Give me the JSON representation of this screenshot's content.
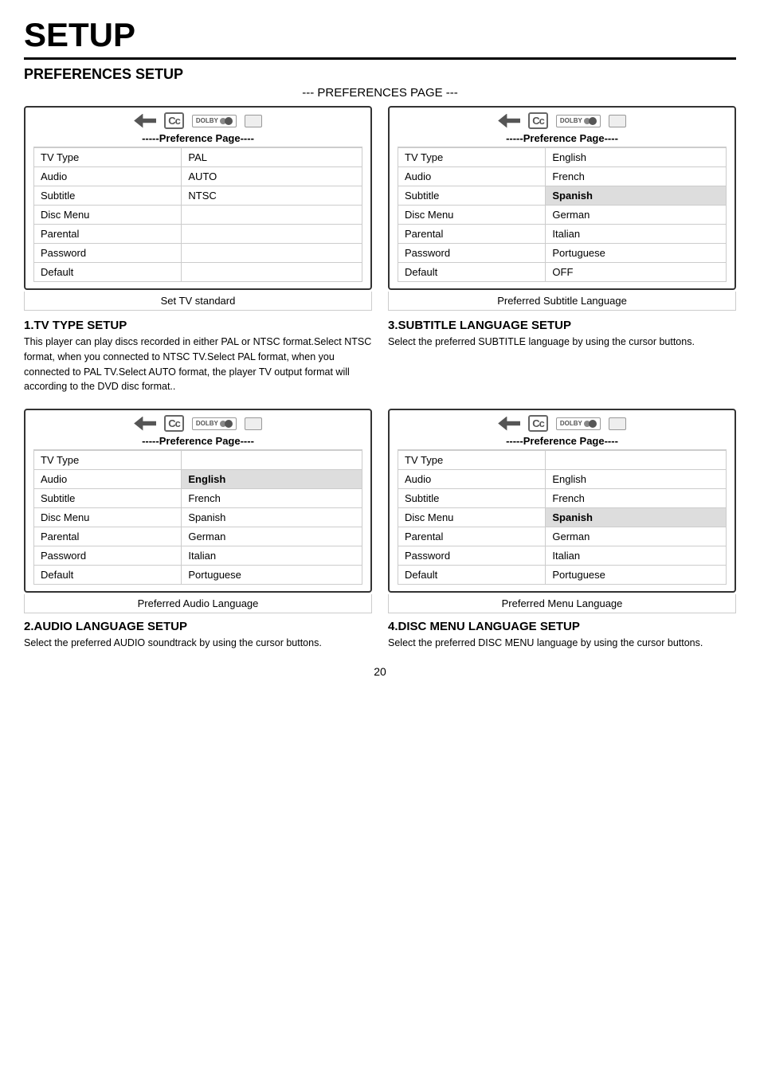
{
  "page": {
    "title": "SETUP",
    "section": "PREFERENCES SETUP",
    "subtitle": "--- PREFERENCES PAGE ---",
    "page_number": "20"
  },
  "icons": {
    "cc": "Cc",
    "dolby": "DOLBY",
    "pref_page": "-----Preference Page----"
  },
  "box1": {
    "footer": "Set TV standard",
    "rows": [
      {
        "label": "TV Type",
        "value": "PAL",
        "highlight": false
      },
      {
        "label": "Audio",
        "value": "AUTO",
        "highlight": false
      },
      {
        "label": "Subtitle",
        "value": "NTSC",
        "highlight": false
      },
      {
        "label": "Disc Menu",
        "value": "",
        "highlight": false
      },
      {
        "label": "Parental",
        "value": "",
        "highlight": false
      },
      {
        "label": "Password",
        "value": "",
        "highlight": false
      },
      {
        "label": "Default",
        "value": "",
        "highlight": false
      }
    ]
  },
  "box2": {
    "footer": "Preferred Subtitle Language",
    "rows": [
      {
        "label": "TV Type",
        "value": "",
        "highlight": false
      },
      {
        "label": "Audio",
        "value": "English",
        "highlight": false
      },
      {
        "label": "Subtitle",
        "value": "French",
        "highlight": false
      },
      {
        "label": "Disc Menu",
        "value": "Spanish",
        "highlight": false
      },
      {
        "label": "Parental",
        "value": "German",
        "highlight": false
      },
      {
        "label": "Password",
        "value": "Italian",
        "highlight": false
      },
      {
        "label": "Default",
        "value": "Portuguese",
        "highlight": false
      }
    ],
    "extra_row": "OFF"
  },
  "box3": {
    "footer": "Preferred Audio Language",
    "rows": [
      {
        "label": "TV Type",
        "value": "",
        "highlight": false
      },
      {
        "label": "Audio",
        "value": "English",
        "highlight": false
      },
      {
        "label": "Subtitle",
        "value": "French",
        "highlight": false
      },
      {
        "label": "Disc Menu",
        "value": "Spanish",
        "highlight": false
      },
      {
        "label": "Parental",
        "value": "German",
        "highlight": false
      },
      {
        "label": "Password",
        "value": "Italian",
        "highlight": false
      },
      {
        "label": "Default",
        "value": "Portuguese",
        "highlight": false
      }
    ]
  },
  "box4": {
    "footer": "Preferred Menu Language",
    "rows": [
      {
        "label": "TV Type",
        "value": "",
        "highlight": false
      },
      {
        "label": "Audio",
        "value": "English",
        "highlight": false
      },
      {
        "label": "Subtitle",
        "value": "French",
        "highlight": false
      },
      {
        "label": "Disc Menu",
        "value": "Spanish",
        "highlight": false
      },
      {
        "label": "Parental",
        "value": "German",
        "highlight": false
      },
      {
        "label": "Password",
        "value": "Italian",
        "highlight": false
      },
      {
        "label": "Default",
        "value": "Portuguese",
        "highlight": false
      }
    ]
  },
  "sections": {
    "s1": {
      "title": "1.TV TYPE SETUP",
      "body": "This player can play discs recorded in either PAL or NTSC format.Select NTSC format, when you connected to NTSC TV.Select PAL format, when you connected to PAL TV.Select AUTO format, the player TV output format will according to the DVD disc format.."
    },
    "s2": {
      "title": "2.AUDIO LANGUAGE SETUP",
      "body": "Select the preferred AUDIO soundtrack by using the cursor buttons."
    },
    "s3": {
      "title": "3.SUBTITLE LANGUAGE SETUP",
      "body": "Select the preferred SUBTITLE language by using the cursor buttons."
    },
    "s4": {
      "title": "4.DISC MENU LANGUAGE SETUP",
      "body": "Select the preferred DISC MENU language by using the cursor buttons."
    }
  }
}
